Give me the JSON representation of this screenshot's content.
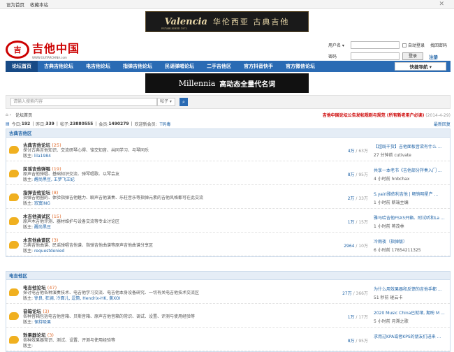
{
  "topbar": {
    "home": "设为首页",
    "fav": "收藏本站"
  },
  "banner1": {
    "brand": "Valencia",
    "cn": "华伦西亚 古典吉他",
    "est": "ESTABLISHED 1972"
  },
  "logo": {
    "mark": "吉",
    "name": "吉他中国",
    "site": "WWW.GUITARCHINA.com"
  },
  "login": {
    "user_label": "用户名 ▾",
    "pass_label": "密码",
    "auto": "自动登录",
    "forgot": "找回密码",
    "login_btn": "登录",
    "register": "注册"
  },
  "nav": {
    "items": [
      "论坛首页",
      "古典吉他论坛",
      "电吉他论坛",
      "指弹吉他论坛",
      "民谣弹唱论坛",
      "二手吉他区",
      "官方抖音快手",
      "官方微信论坛"
    ],
    "quick": "快捷导航 ▾"
  },
  "banner2": {
    "brand": "Millennia",
    "slogan": "高动态全量代名词"
  },
  "search": {
    "placeholder": "请输入搜索内容",
    "type": "帖子 ▾",
    "btn": "⌕"
  },
  "crumb": {
    "home": "⌂ ›",
    "label": "论坛首页",
    "notice": "吉他中国论坛公告发帖规则与规范 (所有新老用户必读)",
    "date": "(2014-4-29)"
  },
  "stats": {
    "today_l": "今日: ",
    "today": "192",
    "y_l": "昨日: ",
    "y": "339",
    "posts_l": "帖子: ",
    "posts": "23880555",
    "mem_l": "会员: ",
    "mem": "1490279",
    "new_l": "欢迎新会员: ",
    "new": "T码毒",
    "last": "最新回复"
  },
  "sections": [
    {
      "title": "古典吉他区",
      "forums": [
        {
          "name": "古典吉他论坛",
          "today": "(25)",
          "desc": "探讨古典吉他知识、交流研琴心得、铭交知音、共同学习、与琴同乐",
          "mod_l": "版主: ",
          "mod": "lila1984",
          "cnt": "4万",
          "cnt2": " / 63万",
          "lp_t": "【超既干货】吉他面板音梁有什么 ...",
          "lp_m": "27 分钟前 cutivate"
        },
        {
          "name": "民谣吉他弹唱",
          "today": "(19)",
          "desc": "原声吉他弹唱、基础知识交流、弹琴唱歌、以琴会友",
          "mod_l": "版主: ",
          "mod": "醒尚黑豆, 王梦飞王妃",
          "cnt": "8万",
          "cnt2": " / 95万",
          "lp_t": "共享一本老书《吉他部分拌奏入门 ...",
          "lp_m": "4 小时前 hnbchax"
        },
        {
          "name": "指弹吉他论坛",
          "today": "(8)",
          "desc": "指弹吉他圈的、体验指弹吉他魅力、聊声吉他演奏、乐柱音乐等指弹元素的吉他风格都可在此交流",
          "mod_l": "版主: ",
          "mod": "寂寞ING",
          "cnt": "2万",
          "cnt2": " / 33万",
          "lp_t": "S.yairi雅依利吉他 | 畅销明星产 ...",
          "lp_m": "1 小时前 薪端主编"
        },
        {
          "name": "木吉他调试区",
          "today": "(15)",
          "desc": "原声木吉他评测、器材维护与设备交流等专业讨论区",
          "mod_l": "版主: ",
          "mod": "醒尚黑豆",
          "cnt": "1万",
          "cnt2": " / 15万",
          "lp_t": "雅马哈吉他FSX5开箱、附试听和La ...",
          "lp_m": "1 小时前 蒋茂林"
        },
        {
          "name": "木吉他曲谱区",
          "today": "(3)",
          "desc": "古典吉他曲谱、民谣弹唱吉他谱、指弹吉他曲谱等原声吉他曲谱分享区",
          "mod_l": "版主: ",
          "mod": "requestdenied",
          "cnt": "2964",
          "cnt2": " / 10万",
          "lp_t": "冷雨夜（指弹版）",
          "lp_m": "6 小时前 17854211325"
        }
      ]
    },
    {
      "title": "电吉他区",
      "forums": [
        {
          "name": "电吉他论坛",
          "today": "(47)",
          "desc": "探讨电吉他各种演奏技术、电吉他学习交流、电吉他本身设备研究、一切有关电吉他技术交流区",
          "mod_l": "版主: ",
          "mod": "徐良, 狂澜, 冷面儿, 逗筒, Hendrix-HK, 黄XOI",
          "cnt": "27万",
          "cnt2": " / 366万",
          "lp_t": "为什么用效果器和反馈的吉他手都 ...",
          "lp_m": "51 秒前 碰云卡"
        },
        {
          "name": "音箱论坛",
          "today": "(3)",
          "desc": "各种音箱包括电吉他音箱、贝斯音箱、原声吉他音箱的常识、调试、设置、评测与使用经验等",
          "mod_l": "版主: ",
          "mod": "保持吸果",
          "cnt": "1万",
          "cnt2": " / 17万",
          "lp_t": "2020 Music China已就绪, 期盼 M ...",
          "lp_m": "5 小时前 月溯之歌"
        },
        {
          "name": "效果器论坛",
          "today": "(3)",
          "desc": "各种效果器常识、测试、设置、评测与使用经验等",
          "mod_l": "版主: ",
          "mod": "",
          "cnt": "8万",
          "cnt2": " / 95万",
          "lp_t": "求用过KPA或者KPS的朋友们进来 ...",
          "lp_m": ""
        }
      ]
    }
  ]
}
